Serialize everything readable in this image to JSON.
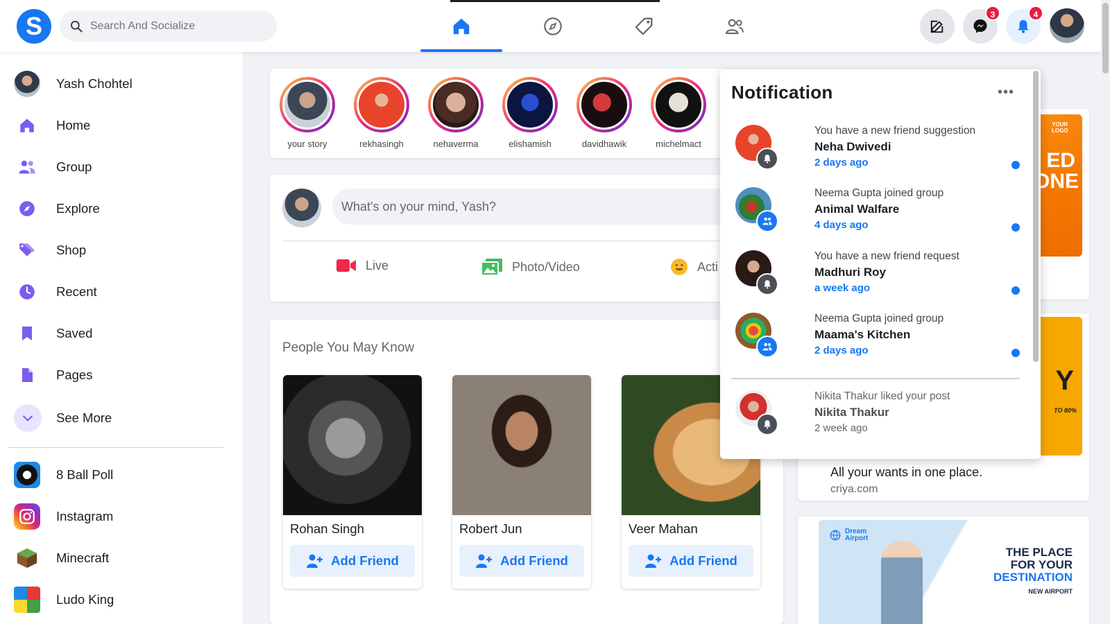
{
  "colors": {
    "brand": "#1877f2",
    "badge": "#e41e3f",
    "purple": "#7b5cf0"
  },
  "header": {
    "logo_letter": "S",
    "search_placeholder": "Search And Socialize",
    "nav_icons": [
      "home-icon",
      "compass-icon",
      "tag-icon",
      "friends-icon"
    ],
    "messenger_count": "3",
    "notification_count": "4"
  },
  "sidebar": {
    "profile_name": "Yash Chohtel",
    "items": [
      {
        "label": "Home",
        "icon": "home-icon"
      },
      {
        "label": "Group",
        "icon": "group-icon"
      },
      {
        "label": "Explore",
        "icon": "compass-icon"
      },
      {
        "label": "Shop",
        "icon": "tag-icon"
      },
      {
        "label": "Recent",
        "icon": "clock-icon"
      },
      {
        "label": "Saved",
        "icon": "bookmark-icon"
      },
      {
        "label": "Pages",
        "icon": "page-icon"
      },
      {
        "label": "See More",
        "icon": "chevron-down-icon"
      }
    ],
    "shortcuts": [
      {
        "label": "8 Ball Poll",
        "icon": "8-ball-pool-icon"
      },
      {
        "label": "Instagram",
        "icon": "instagram-icon"
      },
      {
        "label": "Minecraft",
        "icon": "minecraft-icon"
      },
      {
        "label": "Ludo King",
        "icon": "ludo-king-icon"
      }
    ]
  },
  "stories": [
    {
      "name": "your story"
    },
    {
      "name": "rekhasingh"
    },
    {
      "name": "nehaverma"
    },
    {
      "name": "elishamish"
    },
    {
      "name": "davidhawik"
    },
    {
      "name": "michelmact"
    }
  ],
  "composer": {
    "placeholder": "What's on  your mind, Yash?",
    "actions": [
      {
        "label": "Live",
        "icon": "video-camera-icon"
      },
      {
        "label": "Photo/Video",
        "icon": "photo-icon"
      },
      {
        "label": "Acti",
        "icon": "smiley-icon"
      }
    ]
  },
  "people": {
    "title": "People You May Know",
    "button_label": "Add Friend",
    "list": [
      {
        "name": "Rohan Singh"
      },
      {
        "name": "Robert Jun"
      },
      {
        "name": "Veer Mahan"
      }
    ]
  },
  "ads": {
    "top_badge": "YOUR LOGO",
    "top_text": "ED ONE",
    "middle_text": "Y",
    "middle_small": "TO 80%",
    "tagline": "All your wants in one place.",
    "domain": "criya.com",
    "bottom_brand": "Dream Airport",
    "bottom_headline_1": "THE PLACE",
    "bottom_headline_2": "FOR YOUR",
    "bottom_headline_3": "DESTINATION",
    "bottom_sub": "NEW AIRPORT"
  },
  "notifications": {
    "title": "Notification",
    "more": "•••",
    "items": [
      {
        "line1": "You have a new friend suggestion",
        "name": "Neha Dwivedi",
        "time": "2 days ago",
        "type": "bell",
        "unread": true
      },
      {
        "line1": "Neema Gupta joined group",
        "name": "Animal Walfare",
        "time": "4 days ago",
        "type": "group",
        "unread": true
      },
      {
        "line1": "You have a new friend request",
        "name": "Madhuri Roy",
        "time": "a week ago",
        "type": "bell",
        "unread": true
      },
      {
        "line1": "Neema Gupta joined group",
        "name": "Maama's Kitchen",
        "time": "2 days ago",
        "type": "group",
        "unread": true
      },
      {
        "line1": "Nikita Thakur liked your post",
        "name": "Nikita Thakur",
        "time": "2 week ago",
        "type": "bell",
        "unread": false
      }
    ]
  }
}
